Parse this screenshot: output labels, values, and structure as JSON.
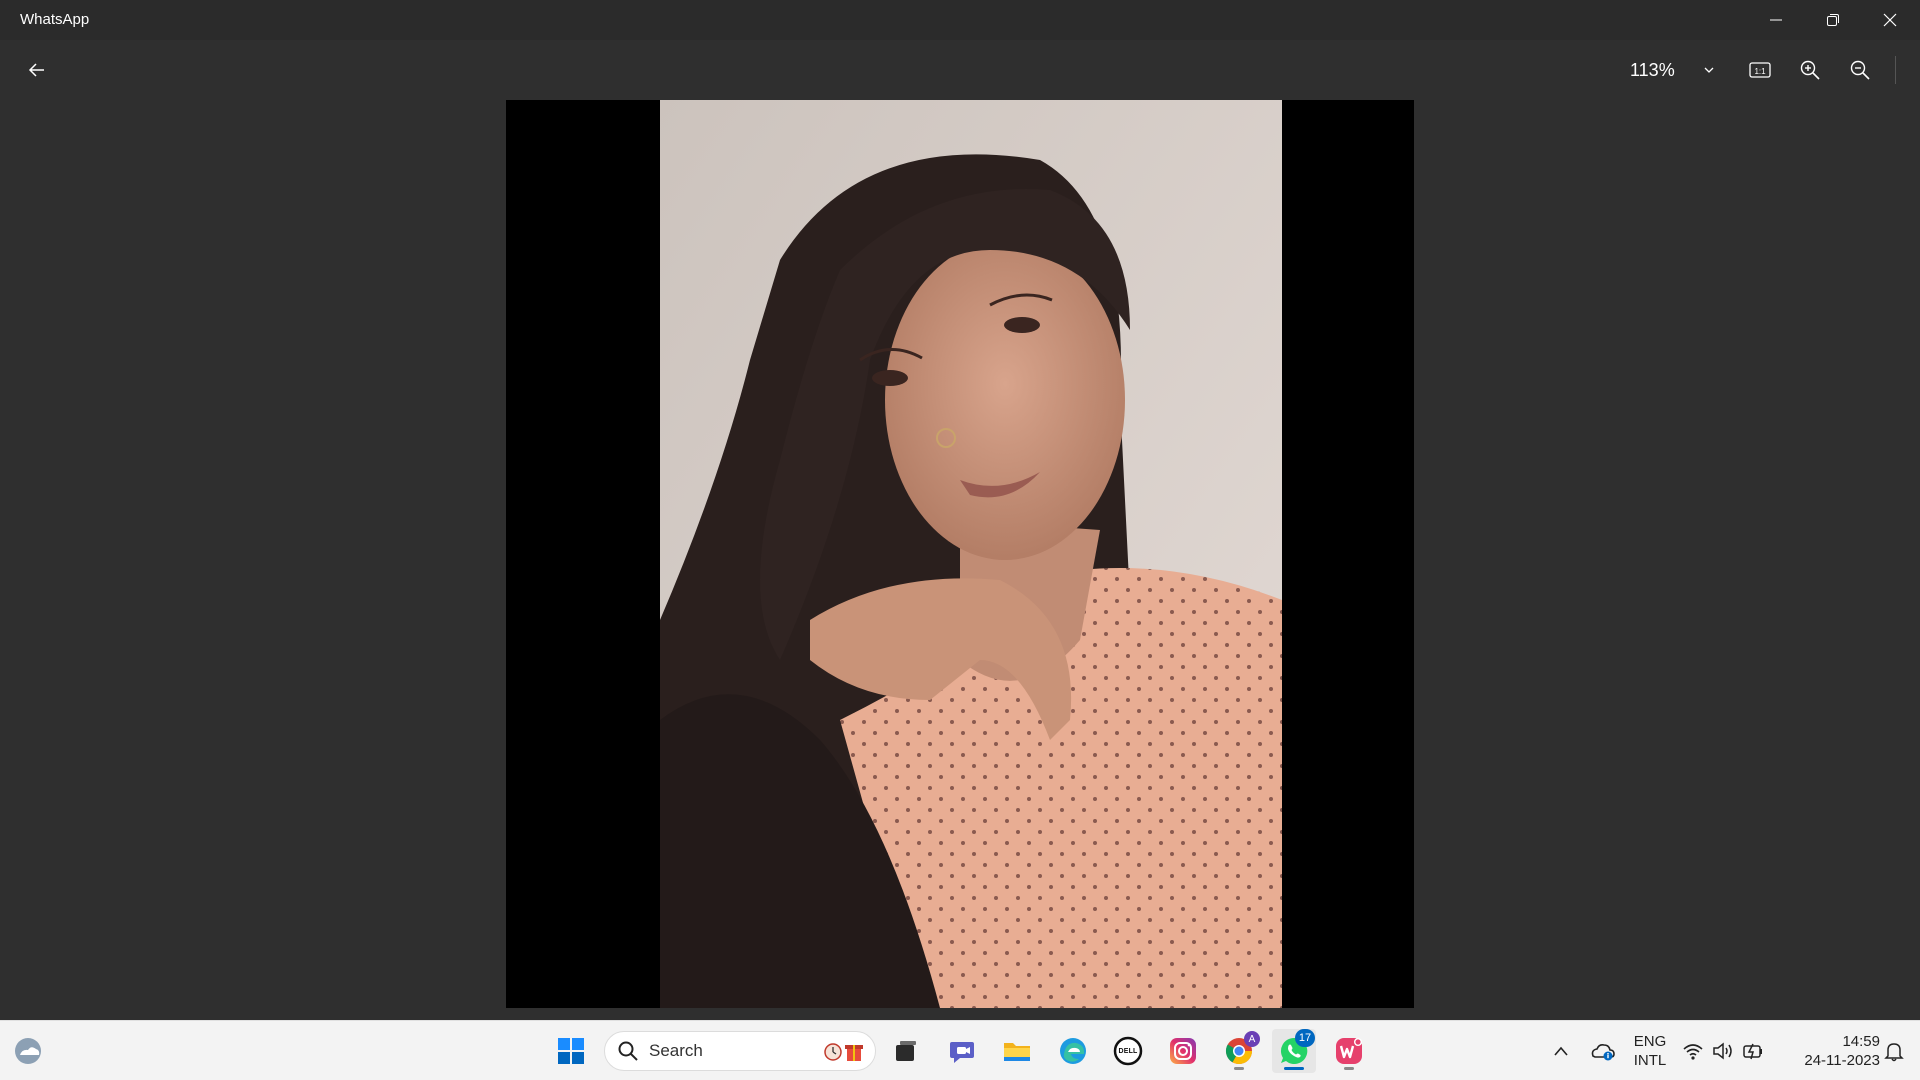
{
  "window": {
    "title": "WhatsApp"
  },
  "toolbar": {
    "zoom_level": "113%"
  },
  "taskbar": {
    "search_label": "Search",
    "whatsapp_badge": "17",
    "chrome_badge": "A",
    "dell_label": "DELL",
    "language_top": "ENG",
    "language_bottom": "INTL",
    "time": "14:59",
    "date": "24-11-2023"
  },
  "colors": {
    "titlebar": "#2b2b2b",
    "background": "#2f2f2f",
    "taskbar": "#f3f3f3",
    "accent": "#0067c0",
    "whatsapp": "#25d366"
  }
}
